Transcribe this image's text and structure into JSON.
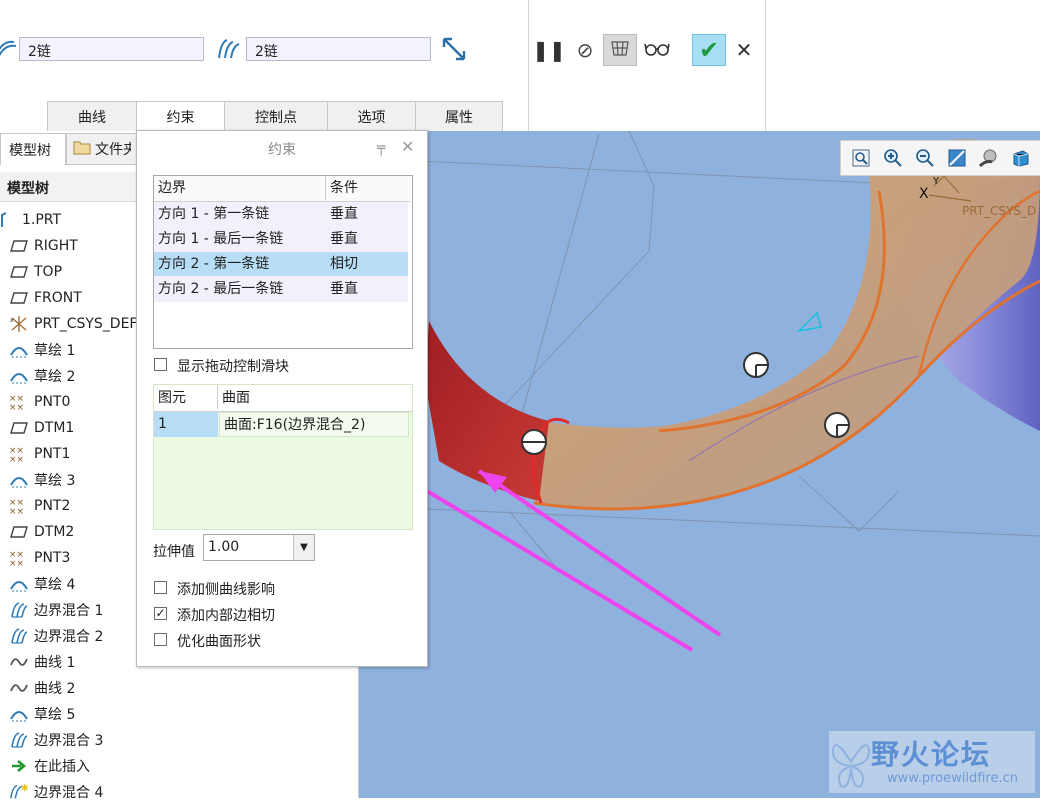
{
  "ribbon": {
    "chain_box_1": "2链",
    "chain_box_2": "2链",
    "tabs": [
      {
        "label": "曲线"
      },
      {
        "label": "约束",
        "active": true
      },
      {
        "label": "控制点"
      },
      {
        "label": "选项"
      },
      {
        "label": "属性"
      }
    ],
    "tools": {
      "pause": "pause-icon",
      "stop": "stop-icon",
      "preview": "mesh-preview-icon",
      "glasses": "glasses-icon",
      "ok": "check-icon",
      "cancel": "close-icon"
    }
  },
  "left_panel": {
    "tabs": [
      "模型树",
      "文件夹"
    ],
    "header": "模型树",
    "items": [
      {
        "label": "1.PRT",
        "icon": "part-icon"
      },
      {
        "label": "RIGHT",
        "icon": "datum-plane-icon"
      },
      {
        "label": "TOP",
        "icon": "datum-plane-icon"
      },
      {
        "label": "FRONT",
        "icon": "datum-plane-icon"
      },
      {
        "label": "PRT_CSYS_DEF",
        "icon": "csys-icon"
      },
      {
        "label": "草绘 1",
        "icon": "sketch-icon"
      },
      {
        "label": "草绘 2",
        "icon": "sketch-icon"
      },
      {
        "label": "PNT0",
        "icon": "datum-point-icon"
      },
      {
        "label": "DTM1",
        "icon": "datum-plane-icon"
      },
      {
        "label": "PNT1",
        "icon": "datum-point-icon"
      },
      {
        "label": "草绘 3",
        "icon": "sketch-icon"
      },
      {
        "label": "PNT2",
        "icon": "datum-point-icon"
      },
      {
        "label": "DTM2",
        "icon": "datum-plane-icon"
      },
      {
        "label": "PNT3",
        "icon": "datum-point-icon"
      },
      {
        "label": "草绘 4",
        "icon": "sketch-icon"
      },
      {
        "label": "边界混合 1",
        "icon": "boundary-blend-icon"
      },
      {
        "label": "边界混合 2",
        "icon": "boundary-blend-icon"
      },
      {
        "label": "曲线 1",
        "icon": "curve-icon"
      },
      {
        "label": "曲线 2",
        "icon": "curve-icon"
      },
      {
        "label": "草绘 5",
        "icon": "sketch-icon"
      },
      {
        "label": "边界混合 3",
        "icon": "boundary-blend-icon"
      },
      {
        "label": "在此插入",
        "icon": "insert-arrow-icon"
      },
      {
        "label": "边界混合 4",
        "icon": "boundary-blend-new-icon"
      }
    ]
  },
  "dialog": {
    "title": "约束",
    "boundary_table": {
      "headers": [
        "边界",
        "条件"
      ],
      "rows": [
        {
          "boundary": "方向 1 - 第一条链",
          "condition": "垂直"
        },
        {
          "boundary": "方向 1 - 最后一条链",
          "condition": "垂直"
        },
        {
          "boundary": "方向 2 - 第一条链",
          "condition": "相切",
          "selected": true
        },
        {
          "boundary": "方向 2 - 最后一条链",
          "condition": "垂直"
        }
      ]
    },
    "show_drag_handles": {
      "label": "显示拖动控制滑块",
      "checked": false
    },
    "entity_table": {
      "headers": [
        "图元",
        "曲面"
      ],
      "rows": [
        {
          "entity": "1",
          "surface": "曲面:F16(边界混合_2)"
        }
      ]
    },
    "stretch": {
      "label": "拉伸值",
      "value": "1.00"
    },
    "options": [
      {
        "label": "添加侧曲线影响",
        "checked": false
      },
      {
        "label": "添加内部边相切",
        "checked": true
      },
      {
        "label": "优化曲面形状",
        "checked": false
      }
    ]
  },
  "viewport": {
    "csys_label": "PRT_CSYS_D",
    "axis_x": "X",
    "axis_y": "Y",
    "toolbar_icons": [
      "zoom-fit-icon",
      "zoom-in-icon",
      "zoom-out-icon",
      "repaint-icon",
      "render-style-icon",
      "view-orient-icon"
    ]
  },
  "watermark": {
    "main": "野火论坛",
    "sub": "www.proewildfire.cn"
  },
  "colors": {
    "viewport_bg": "#8fb1dd",
    "tube_outline": "#e07030",
    "red_surface": "#b02828",
    "arrow": "#ee44ee",
    "selected_row": "#b7ddf7",
    "entity_bg": "#ebfae0"
  }
}
